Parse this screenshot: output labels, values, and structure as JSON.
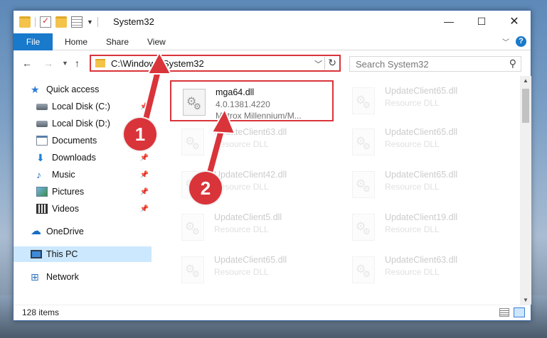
{
  "window": {
    "title": "System32"
  },
  "ribbon": {
    "tabs": [
      "File",
      "Home",
      "Share",
      "View"
    ]
  },
  "address": {
    "path": "C:\\Windows\\System32"
  },
  "search": {
    "placeholder": "Search System32"
  },
  "sidebar": {
    "items": [
      {
        "label": "Quick access",
        "icon": "star-icon",
        "pinned": false
      },
      {
        "label": "Local Disk (C:)",
        "icon": "disk-icon",
        "pinned": true
      },
      {
        "label": "Local Disk (D:)",
        "icon": "disk-icon",
        "pinned": true
      },
      {
        "label": "Documents",
        "icon": "documents-icon",
        "pinned": true
      },
      {
        "label": "Downloads",
        "icon": "downloads-icon",
        "pinned": true
      },
      {
        "label": "Music",
        "icon": "music-icon",
        "pinned": true
      },
      {
        "label": "Pictures",
        "icon": "pictures-icon",
        "pinned": true
      },
      {
        "label": "Videos",
        "icon": "videos-icon",
        "pinned": true
      },
      {
        "label": "OneDrive",
        "icon": "onedrive-icon",
        "pinned": false
      },
      {
        "label": "This PC",
        "icon": "pc-icon",
        "pinned": false,
        "selected": true
      },
      {
        "label": "Network",
        "icon": "network-icon",
        "pinned": false
      }
    ]
  },
  "files": [
    {
      "name": "mga64.dll",
      "line1": "4.0.1381.4220",
      "line2": "Matrox Millennium/M...",
      "highlighted": true
    },
    {
      "name": "UpdateClient65.dll",
      "line1": "Resource DLL"
    },
    {
      "name": "UpdateClient63.dll",
      "line1": "Resource DLL"
    },
    {
      "name": "UpdateClient65.dll",
      "line1": "Resource DLL"
    },
    {
      "name": "UpdateClient42.dll",
      "line1": "Resource DLL"
    },
    {
      "name": "UpdateClient65.dll",
      "line1": "Resource DLL"
    },
    {
      "name": "UpdateClient5.dll",
      "line1": "Resource DLL"
    },
    {
      "name": "UpdateClient19.dll",
      "line1": "Resource DLL"
    },
    {
      "name": "UpdateClient65.dll",
      "line1": "Resource DLL"
    },
    {
      "name": "UpdateClient63.dll",
      "line1": "Resource DLL"
    }
  ],
  "status": {
    "item_count": "128 items"
  },
  "annotations": {
    "step1": "1",
    "step2": "2",
    "color": "#d9343a"
  }
}
